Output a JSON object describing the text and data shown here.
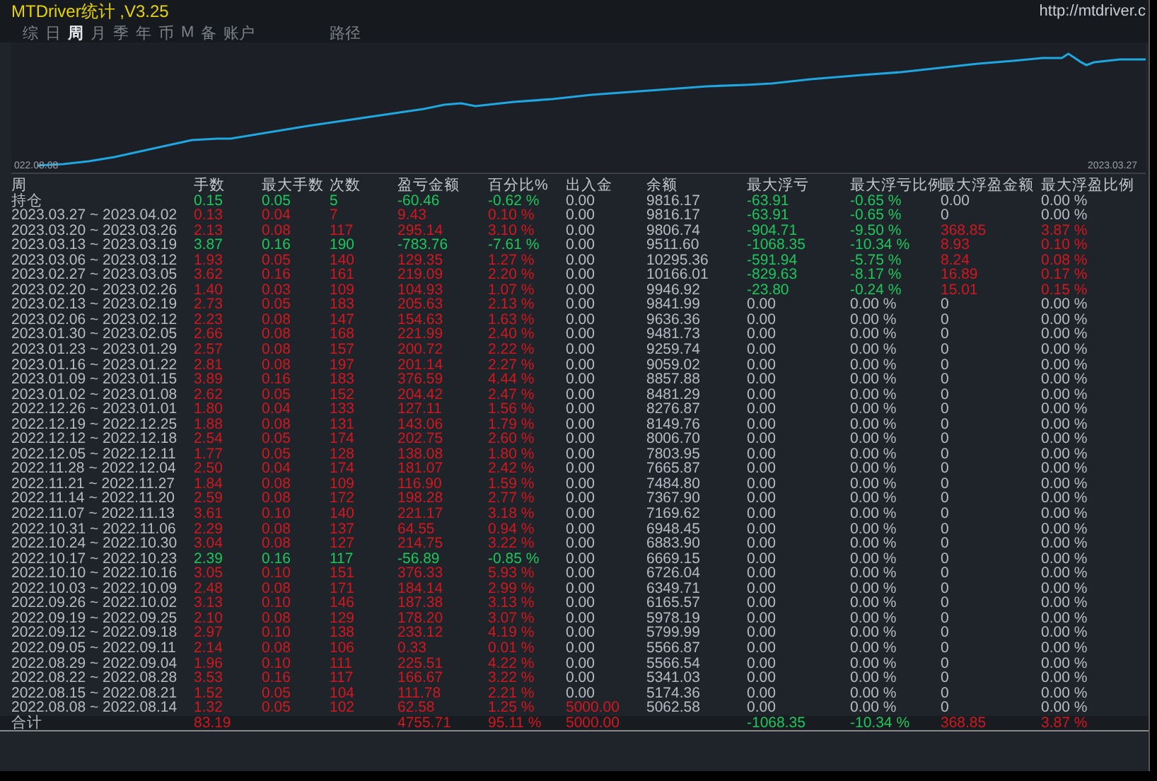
{
  "window": {
    "title": "MTDriver统计 ,V3.25",
    "link": "http://mtdriver.c"
  },
  "tabs": [
    {
      "label": "综",
      "kind": "period",
      "selected": false
    },
    {
      "label": "日",
      "kind": "period",
      "selected": false
    },
    {
      "label": "周",
      "kind": "period",
      "selected": true
    },
    {
      "label": "月",
      "kind": "period",
      "selected": false
    },
    {
      "label": "季",
      "kind": "period",
      "selected": false
    },
    {
      "label": "年",
      "kind": "period",
      "selected": false
    },
    {
      "label": "币",
      "kind": "period",
      "selected": false
    },
    {
      "label": "M",
      "kind": "period",
      "selected": false
    },
    {
      "label": "备",
      "kind": "period",
      "selected": false
    },
    {
      "label": "账户",
      "kind": "period",
      "selected": false
    },
    {
      "label": "路径",
      "kind": "view",
      "selected": false
    }
  ],
  "chart": {
    "start_label": "022.08.08",
    "end_label": "2023.03.27"
  },
  "table": {
    "columns": [
      "周",
      "手数",
      "最大手数",
      "次数",
      "盈亏金额",
      "百分比%",
      "出入金",
      "余额",
      "最大浮亏",
      "最大浮亏比例",
      "最大浮盈金额",
      "最大浮盈比例"
    ],
    "rows": [
      {
        "profit": false,
        "deposit": false,
        "float_loss": true,
        "float_gain": false,
        "cells": [
          "持仓",
          "0.15",
          "0.05",
          "5",
          "-60.46",
          "-0.62 %",
          "0.00",
          "9816.17",
          "-63.91",
          "-0.65 %",
          "0.00",
          "0.00 %"
        ]
      },
      {
        "profit": true,
        "deposit": false,
        "float_loss": true,
        "float_gain": false,
        "cells": [
          "2023.03.27 ~ 2023.04.02",
          "0.13",
          "0.04",
          "7",
          "9.43",
          "0.10 %",
          "0.00",
          "9816.17",
          "-63.91",
          "-0.65 %",
          "0",
          "0.00 %"
        ]
      },
      {
        "profit": true,
        "deposit": false,
        "float_loss": true,
        "float_gain": true,
        "cells": [
          "2023.03.20 ~ 2023.03.26",
          "2.13",
          "0.08",
          "117",
          "295.14",
          "3.10 %",
          "0.00",
          "9806.74",
          "-904.71",
          "-9.50 %",
          "368.85",
          "3.87 %"
        ]
      },
      {
        "profit": false,
        "deposit": false,
        "float_loss": true,
        "float_gain": true,
        "cells": [
          "2023.03.13 ~ 2023.03.19",
          "3.87",
          "0.16",
          "190",
          "-783.76",
          "-7.61 %",
          "0.00",
          "9511.60",
          "-1068.35",
          "-10.34 %",
          "8.93",
          "0.10 %"
        ]
      },
      {
        "profit": true,
        "deposit": false,
        "float_loss": true,
        "float_gain": true,
        "cells": [
          "2023.03.06 ~ 2023.03.12",
          "1.93",
          "0.05",
          "140",
          "129.35",
          "1.27 %",
          "0.00",
          "10295.36",
          "-591.94",
          "-5.75 %",
          "8.24",
          "0.08 %"
        ]
      },
      {
        "profit": true,
        "deposit": false,
        "float_loss": true,
        "float_gain": true,
        "cells": [
          "2023.02.27 ~ 2023.03.05",
          "3.62",
          "0.16",
          "161",
          "219.09",
          "2.20 %",
          "0.00",
          "10166.01",
          "-829.63",
          "-8.17 %",
          "16.89",
          "0.17 %"
        ]
      },
      {
        "profit": true,
        "deposit": false,
        "float_loss": true,
        "float_gain": true,
        "cells": [
          "2023.02.20 ~ 2023.02.26",
          "1.40",
          "0.03",
          "109",
          "104.93",
          "1.07 %",
          "0.00",
          "9946.92",
          "-23.80",
          "-0.24 %",
          "15.01",
          "0.15 %"
        ]
      },
      {
        "profit": true,
        "deposit": false,
        "float_loss": false,
        "float_gain": false,
        "cells": [
          "2023.02.13 ~ 2023.02.19",
          "2.73",
          "0.05",
          "183",
          "205.63",
          "2.13 %",
          "0.00",
          "9841.99",
          "0.00",
          "0.00 %",
          "0",
          "0.00 %"
        ]
      },
      {
        "profit": true,
        "deposit": false,
        "float_loss": false,
        "float_gain": false,
        "cells": [
          "2023.02.06 ~ 2023.02.12",
          "2.23",
          "0.08",
          "147",
          "154.63",
          "1.63 %",
          "0.00",
          "9636.36",
          "0.00",
          "0.00 %",
          "0",
          "0.00 %"
        ]
      },
      {
        "profit": true,
        "deposit": false,
        "float_loss": false,
        "float_gain": false,
        "cells": [
          "2023.01.30 ~ 2023.02.05",
          "2.66",
          "0.08",
          "168",
          "221.99",
          "2.40 %",
          "0.00",
          "9481.73",
          "0.00",
          "0.00 %",
          "0",
          "0.00 %"
        ]
      },
      {
        "profit": true,
        "deposit": false,
        "float_loss": false,
        "float_gain": false,
        "cells": [
          "2023.01.23 ~ 2023.01.29",
          "2.57",
          "0.08",
          "157",
          "200.72",
          "2.22 %",
          "0.00",
          "9259.74",
          "0.00",
          "0.00 %",
          "0",
          "0.00 %"
        ]
      },
      {
        "profit": true,
        "deposit": false,
        "float_loss": false,
        "float_gain": false,
        "cells": [
          "2023.01.16 ~ 2023.01.22",
          "2.81",
          "0.08",
          "197",
          "201.14",
          "2.27 %",
          "0.00",
          "9059.02",
          "0.00",
          "0.00 %",
          "0",
          "0.00 %"
        ]
      },
      {
        "profit": true,
        "deposit": false,
        "float_loss": false,
        "float_gain": false,
        "cells": [
          "2023.01.09 ~ 2023.01.15",
          "3.89",
          "0.16",
          "183",
          "376.59",
          "4.44 %",
          "0.00",
          "8857.88",
          "0.00",
          "0.00 %",
          "0",
          "0.00 %"
        ]
      },
      {
        "profit": true,
        "deposit": false,
        "float_loss": false,
        "float_gain": false,
        "cells": [
          "2023.01.02 ~ 2023.01.08",
          "2.62",
          "0.05",
          "152",
          "204.42",
          "2.47 %",
          "0.00",
          "8481.29",
          "0.00",
          "0.00 %",
          "0",
          "0.00 %"
        ]
      },
      {
        "profit": true,
        "deposit": false,
        "float_loss": false,
        "float_gain": false,
        "cells": [
          "2022.12.26 ~ 2023.01.01",
          "1.80",
          "0.04",
          "133",
          "127.11",
          "1.56 %",
          "0.00",
          "8276.87",
          "0.00",
          "0.00 %",
          "0",
          "0.00 %"
        ]
      },
      {
        "profit": true,
        "deposit": false,
        "float_loss": false,
        "float_gain": false,
        "cells": [
          "2022.12.19 ~ 2022.12.25",
          "1.88",
          "0.08",
          "131",
          "143.06",
          "1.79 %",
          "0.00",
          "8149.76",
          "0.00",
          "0.00 %",
          "0",
          "0.00 %"
        ]
      },
      {
        "profit": true,
        "deposit": false,
        "float_loss": false,
        "float_gain": false,
        "cells": [
          "2022.12.12 ~ 2022.12.18",
          "2.54",
          "0.05",
          "174",
          "202.75",
          "2.60 %",
          "0.00",
          "8006.70",
          "0.00",
          "0.00 %",
          "0",
          "0.00 %"
        ]
      },
      {
        "profit": true,
        "deposit": false,
        "float_loss": false,
        "float_gain": false,
        "cells": [
          "2022.12.05 ~ 2022.12.11",
          "1.77",
          "0.05",
          "128",
          "138.08",
          "1.80 %",
          "0.00",
          "7803.95",
          "0.00",
          "0.00 %",
          "0",
          "0.00 %"
        ]
      },
      {
        "profit": true,
        "deposit": false,
        "float_loss": false,
        "float_gain": false,
        "cells": [
          "2022.11.28 ~ 2022.12.04",
          "2.50",
          "0.04",
          "174",
          "181.07",
          "2.42 %",
          "0.00",
          "7665.87",
          "0.00",
          "0.00 %",
          "0",
          "0.00 %"
        ]
      },
      {
        "profit": true,
        "deposit": false,
        "float_loss": false,
        "float_gain": false,
        "cells": [
          "2022.11.21 ~ 2022.11.27",
          "1.84",
          "0.08",
          "109",
          "116.90",
          "1.59 %",
          "0.00",
          "7484.80",
          "0.00",
          "0.00 %",
          "0",
          "0.00 %"
        ]
      },
      {
        "profit": true,
        "deposit": false,
        "float_loss": false,
        "float_gain": false,
        "cells": [
          "2022.11.14 ~ 2022.11.20",
          "2.59",
          "0.08",
          "172",
          "198.28",
          "2.77 %",
          "0.00",
          "7367.90",
          "0.00",
          "0.00 %",
          "0",
          "0.00 %"
        ]
      },
      {
        "profit": true,
        "deposit": false,
        "float_loss": false,
        "float_gain": false,
        "cells": [
          "2022.11.07 ~ 2022.11.13",
          "3.61",
          "0.10",
          "140",
          "221.17",
          "3.18 %",
          "0.00",
          "7169.62",
          "0.00",
          "0.00 %",
          "0",
          "0.00 %"
        ]
      },
      {
        "profit": true,
        "deposit": false,
        "float_loss": false,
        "float_gain": false,
        "cells": [
          "2022.10.31 ~ 2022.11.06",
          "2.29",
          "0.08",
          "137",
          "64.55",
          "0.94 %",
          "0.00",
          "6948.45",
          "0.00",
          "0.00 %",
          "0",
          "0.00 %"
        ]
      },
      {
        "profit": true,
        "deposit": false,
        "float_loss": false,
        "float_gain": false,
        "cells": [
          "2022.10.24 ~ 2022.10.30",
          "3.04",
          "0.08",
          "127",
          "214.75",
          "3.22 %",
          "0.00",
          "6883.90",
          "0.00",
          "0.00 %",
          "0",
          "0.00 %"
        ]
      },
      {
        "profit": false,
        "deposit": false,
        "float_loss": false,
        "float_gain": false,
        "cells": [
          "2022.10.17 ~ 2022.10.23",
          "2.39",
          "0.16",
          "117",
          "-56.89",
          "-0.85 %",
          "0.00",
          "6669.15",
          "0.00",
          "0.00 %",
          "0",
          "0.00 %"
        ]
      },
      {
        "profit": true,
        "deposit": false,
        "float_loss": false,
        "float_gain": false,
        "cells": [
          "2022.10.10 ~ 2022.10.16",
          "3.05",
          "0.10",
          "151",
          "376.33",
          "5.93 %",
          "0.00",
          "6726.04",
          "0.00",
          "0.00 %",
          "0",
          "0.00 %"
        ]
      },
      {
        "profit": true,
        "deposit": false,
        "float_loss": false,
        "float_gain": false,
        "cells": [
          "2022.10.03 ~ 2022.10.09",
          "2.48",
          "0.08",
          "171",
          "184.14",
          "2.99 %",
          "0.00",
          "6349.71",
          "0.00",
          "0.00 %",
          "0",
          "0.00 %"
        ]
      },
      {
        "profit": true,
        "deposit": false,
        "float_loss": false,
        "float_gain": false,
        "cells": [
          "2022.09.26 ~ 2022.10.02",
          "3.13",
          "0.10",
          "146",
          "187.38",
          "3.13 %",
          "0.00",
          "6165.57",
          "0.00",
          "0.00 %",
          "0",
          "0.00 %"
        ]
      },
      {
        "profit": true,
        "deposit": false,
        "float_loss": false,
        "float_gain": false,
        "cells": [
          "2022.09.19 ~ 2022.09.25",
          "2.10",
          "0.08",
          "129",
          "178.20",
          "3.07 %",
          "0.00",
          "5978.19",
          "0.00",
          "0.00 %",
          "0",
          "0.00 %"
        ]
      },
      {
        "profit": true,
        "deposit": false,
        "float_loss": false,
        "float_gain": false,
        "cells": [
          "2022.09.12 ~ 2022.09.18",
          "2.97",
          "0.10",
          "138",
          "233.12",
          "4.19 %",
          "0.00",
          "5799.99",
          "0.00",
          "0.00 %",
          "0",
          "0.00 %"
        ]
      },
      {
        "profit": true,
        "deposit": false,
        "float_loss": false,
        "float_gain": false,
        "cells": [
          "2022.09.05 ~ 2022.09.11",
          "2.14",
          "0.08",
          "106",
          "0.33",
          "0.01 %",
          "0.00",
          "5566.87",
          "0.00",
          "0.00 %",
          "0",
          "0.00 %"
        ]
      },
      {
        "profit": true,
        "deposit": false,
        "float_loss": false,
        "float_gain": false,
        "cells": [
          "2022.08.29 ~ 2022.09.04",
          "1.96",
          "0.10",
          "111",
          "225.51",
          "4.22 %",
          "0.00",
          "5566.54",
          "0.00",
          "0.00 %",
          "0",
          "0.00 %"
        ]
      },
      {
        "profit": true,
        "deposit": false,
        "float_loss": false,
        "float_gain": false,
        "cells": [
          "2022.08.22 ~ 2022.08.28",
          "3.53",
          "0.16",
          "117",
          "166.67",
          "3.22 %",
          "0.00",
          "5341.03",
          "0.00",
          "0.00 %",
          "0",
          "0.00 %"
        ]
      },
      {
        "profit": true,
        "deposit": false,
        "float_loss": false,
        "float_gain": false,
        "cells": [
          "2022.08.15 ~ 2022.08.21",
          "1.52",
          "0.05",
          "104",
          "111.78",
          "2.21 %",
          "0.00",
          "5174.36",
          "0.00",
          "0.00 %",
          "0",
          "0.00 %"
        ]
      },
      {
        "profit": true,
        "deposit": true,
        "float_loss": false,
        "float_gain": false,
        "cells": [
          "2022.08.08 ~ 2022.08.14",
          "1.32",
          "0.05",
          "102",
          "62.58",
          "1.25 %",
          "5000.00",
          "5062.58",
          "0.00",
          "0.00 %",
          "0",
          "0.00 %"
        ]
      },
      {
        "profit": true,
        "deposit": true,
        "float_loss": true,
        "float_gain": true,
        "cells": [
          "合计",
          "83.19",
          "",
          "",
          "4755.71",
          "95.11 %",
          "5000.00",
          "",
          "-1068.35",
          "-10.34 %",
          "368.85",
          "3.87 %"
        ]
      }
    ]
  }
}
